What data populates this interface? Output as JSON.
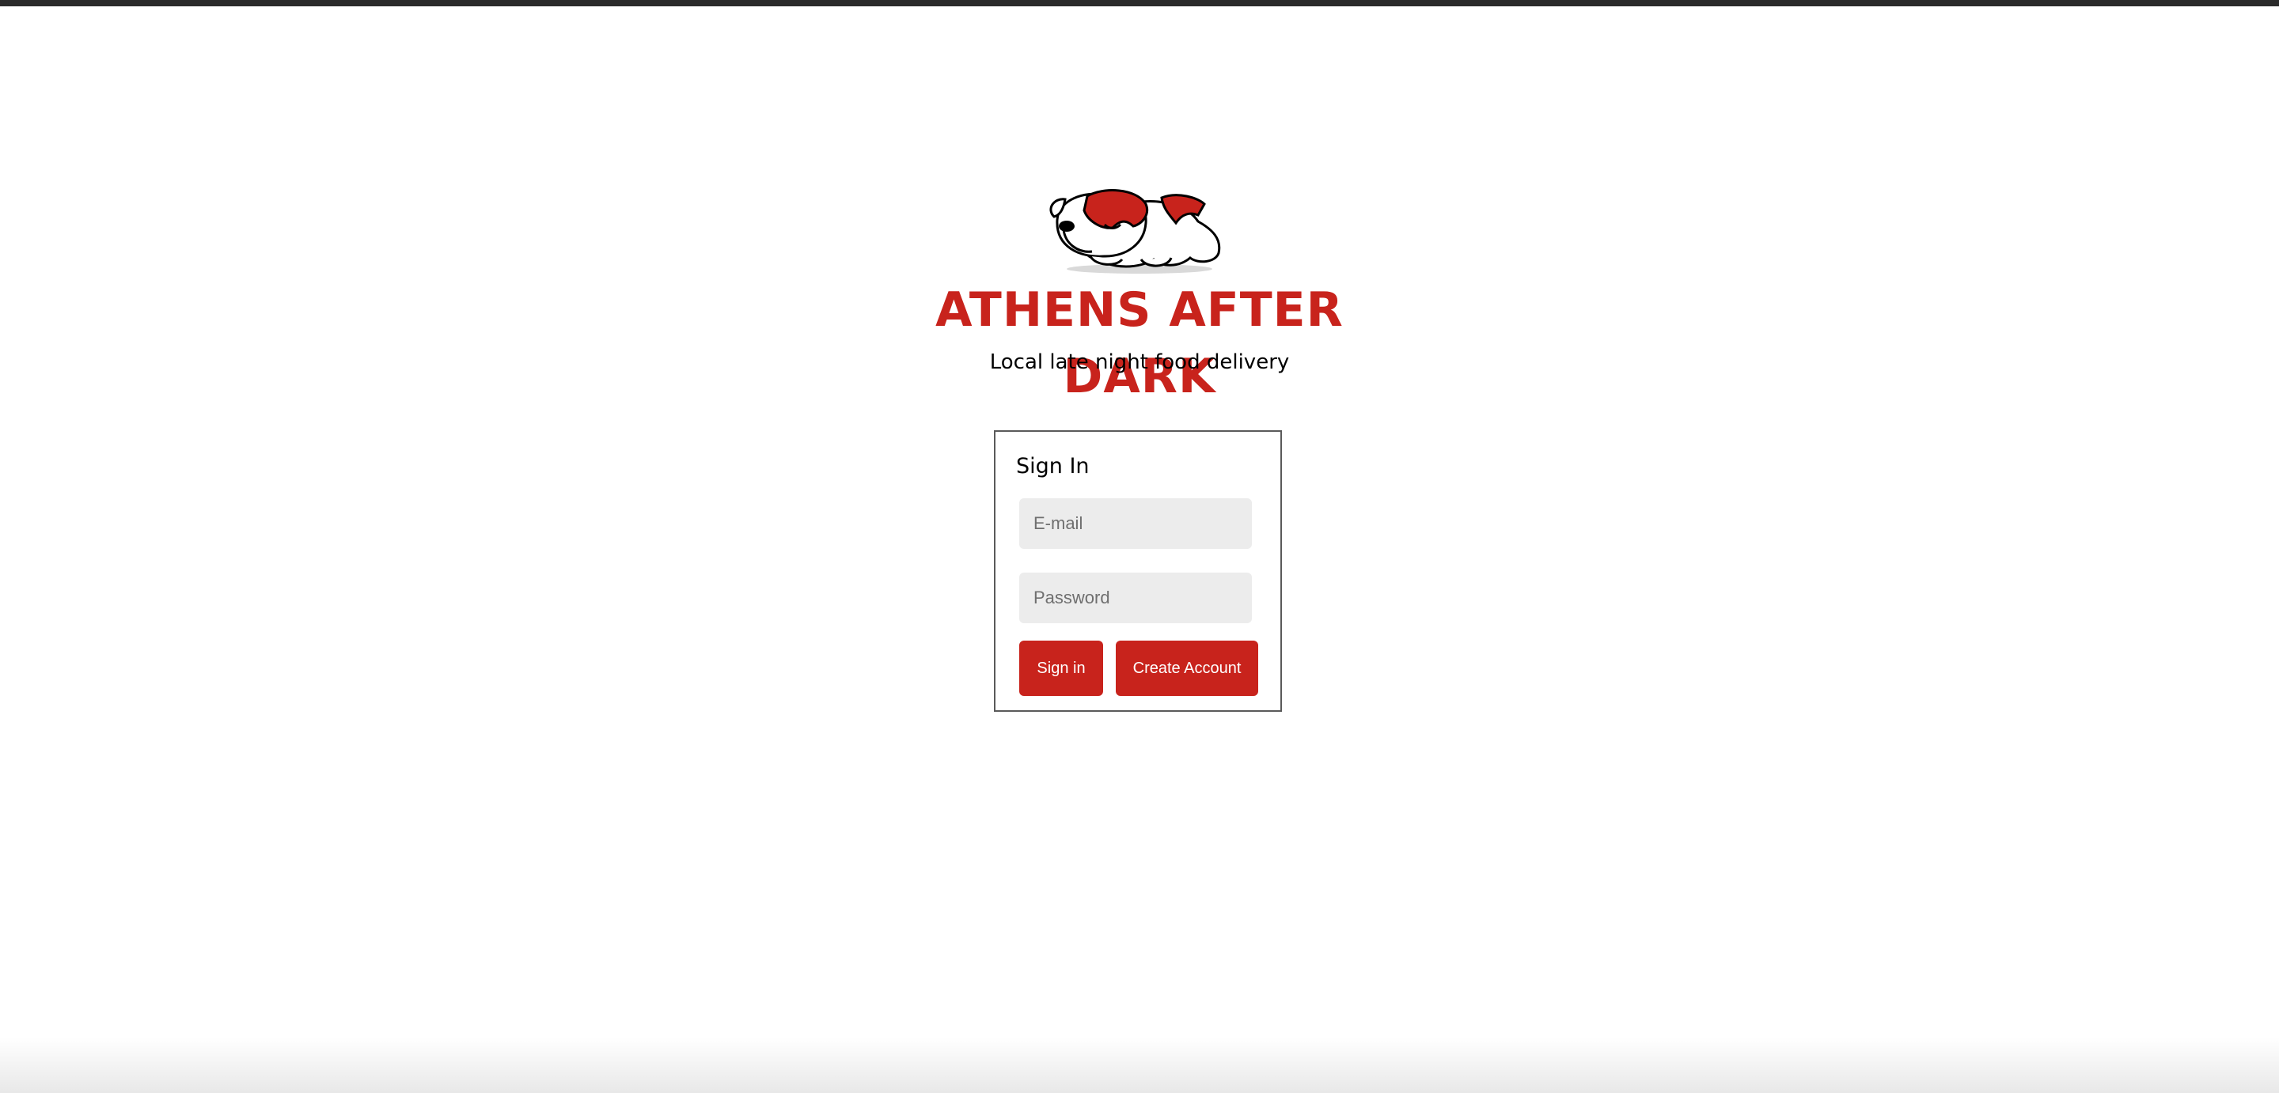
{
  "brand": {
    "title": "ATHENS AFTER DARK",
    "tagline": "Local late night food delivery",
    "logo_icon": "sleeping-bulldog-logo",
    "accent_color": "#c8231c"
  },
  "signin": {
    "title": "Sign In",
    "email_placeholder": "E-mail",
    "password_placeholder": "Password",
    "signin_label": "Sign in",
    "create_account_label": "Create Account"
  }
}
